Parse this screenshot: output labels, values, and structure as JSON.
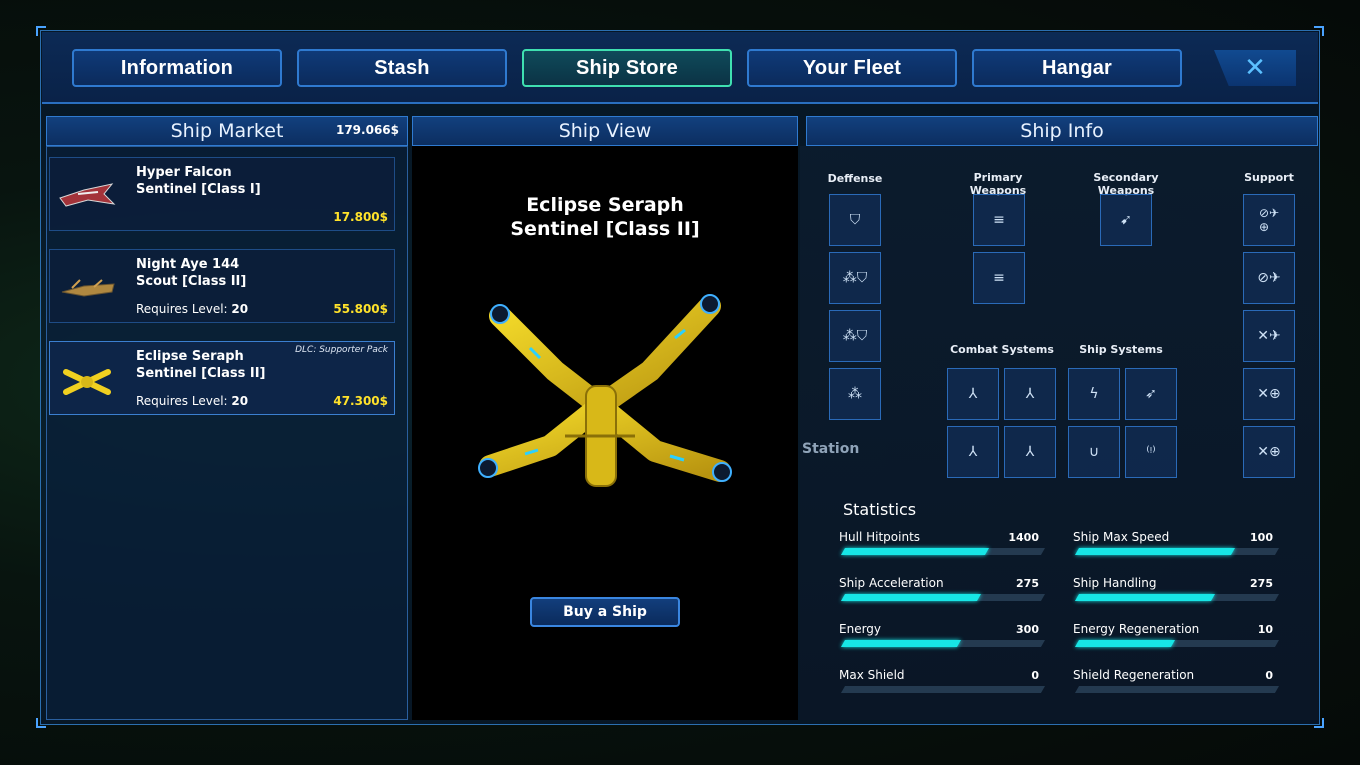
{
  "nav": {
    "tabs": [
      {
        "label": "Information"
      },
      {
        "label": "Stash"
      },
      {
        "label": "Ship Store"
      },
      {
        "label": "Your Fleet"
      },
      {
        "label": "Hangar"
      }
    ],
    "active_tab": "Ship Store",
    "close_icon": "close-icon"
  },
  "market": {
    "title": "Ship Market",
    "balance": "179.066$",
    "items": [
      {
        "name_line1": "Hyper Falcon",
        "name_line2": "Sentinel [Class I]",
        "requires_label": "",
        "requires_level": "",
        "price": "17.800$",
        "dlc": "",
        "color": "#c0392b"
      },
      {
        "name_line1": "Night Aye 144",
        "name_line2": "Scout [Class II]",
        "requires_label": "Requires Level:",
        "requires_level": "20",
        "price": "55.800$",
        "dlc": "",
        "color": "#c9a24a"
      },
      {
        "name_line1": "Eclipse Seraph",
        "name_line2": "Sentinel [Class II]",
        "requires_label": "Requires Level:",
        "requires_level": "20",
        "price": "47.300$",
        "dlc": "DLC: Supporter Pack",
        "color": "#f0d020"
      }
    ]
  },
  "view": {
    "title": "Ship View",
    "ship_name_line1": "Eclipse Seraph",
    "ship_name_line2": "Sentinel [Class II]",
    "buy_label": "Buy a Ship"
  },
  "info": {
    "title": "Ship Info",
    "sections": {
      "defense": "Deffense",
      "primary": "Primary Weapons",
      "secondary": "Secondary Weapons",
      "support": "Support",
      "combat": "Combat Systems",
      "ship_systems": "Ship Systems"
    },
    "background_label": "Station",
    "stats_title": "Statistics",
    "stats": [
      {
        "label": "Hull Hitpoints",
        "value": "1400",
        "fill": 0.72
      },
      {
        "label": "Ship Max Speed",
        "value": "100",
        "fill": 0.78
      },
      {
        "label": "Ship Acceleration",
        "value": "275",
        "fill": 0.68
      },
      {
        "label": "Ship Handling",
        "value": "275",
        "fill": 0.68
      },
      {
        "label": "Energy",
        "value": "300",
        "fill": 0.58
      },
      {
        "label": "Energy Regeneration",
        "value": "10",
        "fill": 0.48
      },
      {
        "label": "Max Shield",
        "value": "0",
        "fill": 0
      },
      {
        "label": "Shield Regeneration",
        "value": "0",
        "fill": 0
      }
    ]
  },
  "colors": {
    "accent": "#2f7ad0",
    "active_tab_border": "#3fe0b0",
    "price": "#ffe22a",
    "stat_fill": "#17e6e6"
  }
}
